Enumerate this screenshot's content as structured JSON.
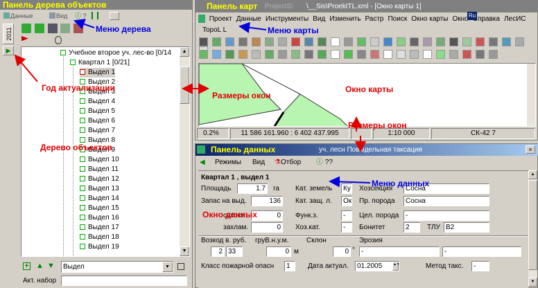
{
  "tree_panel": {
    "title": "Панель дерева объектов",
    "toolbar": {
      "data_label": "Данные",
      "view_label": "Вид",
      "help_label": "?"
    },
    "vertical_tab": "2011",
    "nodes": {
      "forestry": "Учебное второе уч. лес-во [0/14",
      "kvartal": "Квартал 1 [0/21]",
      "items": [
        "Выдел 1",
        "Выдел 2",
        "Выдел 3",
        "Выдел 4",
        "Выдел 5",
        "Выдел 6",
        "Выдел 7",
        "Выдел 8",
        "Выдел 9",
        "Выдел 10",
        "Выдел 11",
        "Выдел 12",
        "Выдел 13",
        "Выдел 14",
        "Выдел 15",
        "Выдел 16",
        "Выдел 17",
        "Выдел 18",
        "Выдел 19"
      ]
    },
    "select_value": "Выдел",
    "act_label": "Акт. набор",
    "act_value": ""
  },
  "map_panel": {
    "title": "Панель карт",
    "window_title": "\\__Sis\\ProektTL.xml - [Окно карты 1]",
    "window_title_prefix": "ProjectS\\",
    "menu": [
      "Проект",
      "Данные",
      "Инструменты",
      "Вид",
      "Изменить",
      "Растр",
      "Поиск",
      "Окно карты",
      "Окно",
      "Справка",
      "ЛесИС"
    ],
    "menu_second_row": "TopoL L",
    "lang_badge": "Ru",
    "status": {
      "zoom": "0.2%",
      "coords": "11 586 161.960 : 6 402 437.995",
      "scale": "1:10 000",
      "crs": "СК-42 7"
    }
  },
  "data_panel": {
    "title": "Панель данных",
    "window_title": "уч. лесн    Повыдельная таксация",
    "menu": {
      "modes": "Режимы",
      "view": "Вид",
      "filter": "Отбор",
      "help": "??"
    },
    "header": "Квартал 1 , выдел 1",
    "fields": {
      "area_label": "Площадь",
      "area_value": "1.7",
      "area_unit": "га",
      "stock_label": "Запас на выд.",
      "stock_value": "136",
      "dry_label": "сухост.",
      "dry_value": "0",
      "litter_label": "захлам.",
      "litter_value": "0",
      "land_cat_label": "Кат. земель",
      "land_cat_value": "Ку",
      "prot_cat_label": "Кат. защ. л.",
      "prot_cat_value": "Ок",
      "func_label": "Функ.з.",
      "func_value": "-",
      "econ_cat_label": "Хоз.кат.",
      "econ_cat_value": "-",
      "hoz_section_label": "Хозсекция",
      "hoz_section_value": "Сосна",
      "pr_breed_label": "Пр. порода",
      "pr_breed_value": "Сосна",
      "target_breed_label": "Цел. порода",
      "target_breed_value": "-",
      "bonitet_label": "Бонитет",
      "bonitet_value": "2",
      "tlu_label": "ТЛУ",
      "tlu_value": "В2",
      "age_label": "Возкод в. руб.",
      "age_v1": "2",
      "age_v2": "33",
      "height_label": "груВ.н.у.м.",
      "height_value": "0",
      "height_unit": "м",
      "slope_label": "Склон",
      "slope_value": "0",
      "slope_unit": "°",
      "erosion_label": "Эрозия",
      "erosion_v1": "-",
      "erosion_v2": "-",
      "fire_label": "Класс пожарной опасн",
      "fire_value": "1",
      "date_label": "Дата актуал.",
      "date_value": "01.2005",
      "method_label": "Метод такс.",
      "method_value": "-"
    }
  },
  "annotations": {
    "tree_menu": "Меню дерева",
    "map_menu": "Меню карты",
    "data_menu": "Меню данных",
    "year": "Год актуализации",
    "win_sizes1": "Размеры окон",
    "win_sizes2": "Размеры окон",
    "map_window": "Окно карты",
    "tree": "Дерево объектов",
    "data_window": "Окно данных"
  },
  "colors": {
    "annot_red": "#e00000",
    "annot_blue": "#0000dd",
    "annot_yellow": "#ffff00",
    "map_green": "#b8f5b0",
    "title_bar": "#0a246a"
  }
}
